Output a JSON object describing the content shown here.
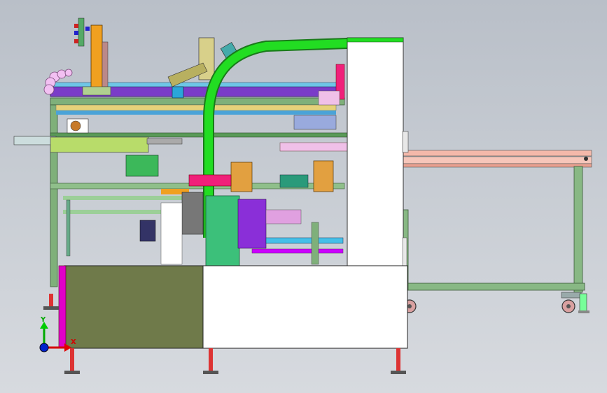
{
  "viewport": {
    "description_free": true,
    "triad": {
      "x_label": "X",
      "y_label": "Y"
    }
  },
  "colors": {
    "background_top": "#b9bfc8",
    "frame_green": "#7fb07a",
    "tube_green": "#22dd22",
    "cabinet_white": "#ffffff",
    "olive_panel": "#6f7a4a",
    "orange_part": "#f0a020",
    "magenta_part": "#e0007a",
    "purple_rail": "#7a3cc8",
    "conveyor_salmon": "#f3b0a0"
  },
  "icons": [
    "axis-triad-icon",
    "caster-wheel-icon",
    "leveling-foot-icon",
    "cable-chain-icon"
  ]
}
